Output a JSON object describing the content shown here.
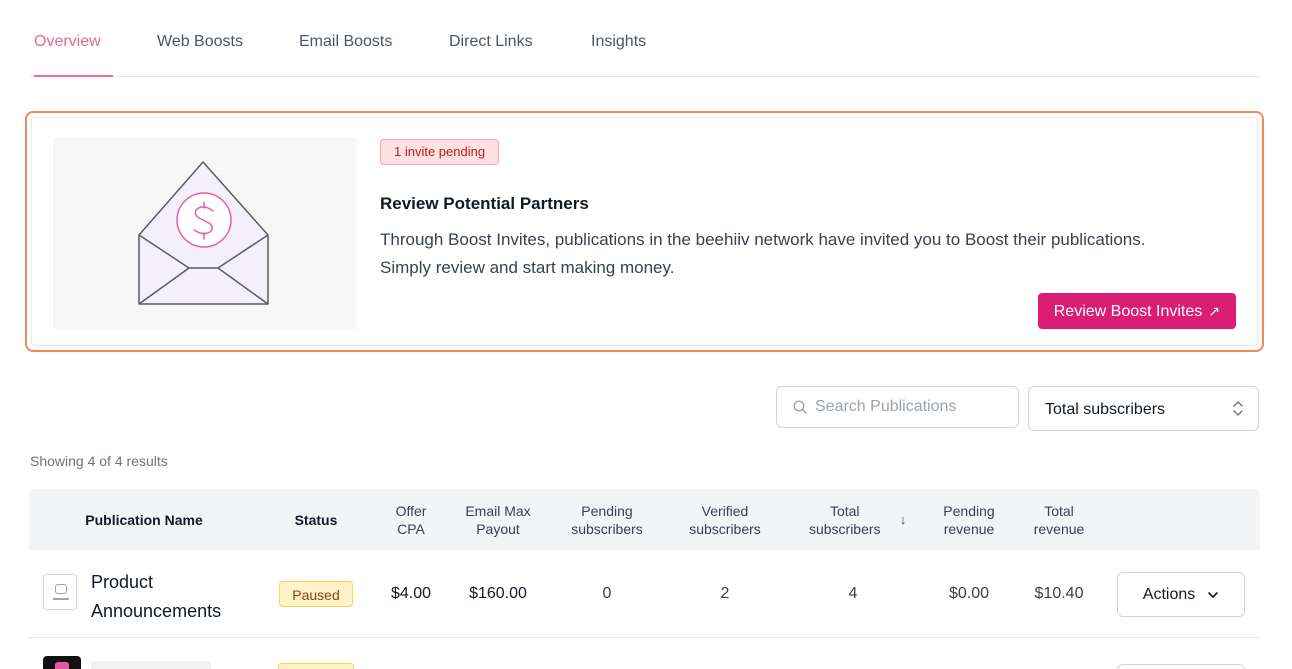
{
  "tabs": [
    {
      "label": "Overview",
      "active": true
    },
    {
      "label": "Web Boosts",
      "active": false
    },
    {
      "label": "Email Boosts",
      "active": false
    },
    {
      "label": "Direct Links",
      "active": false
    },
    {
      "label": "Insights",
      "active": false
    }
  ],
  "banner": {
    "badge": "1 invite pending",
    "title": "Review Potential Partners",
    "description": "Through Boost Invites, publications in the beehiiv network have invited you to Boost their publications. Simply review and start making money.",
    "button_label": "Review Boost Invites",
    "button_icon": "arrow-up-right-icon",
    "illustration_icon": "envelope-dollar-icon"
  },
  "search": {
    "placeholder": "Search Publications",
    "value": ""
  },
  "sort": {
    "selected": "Total subscribers"
  },
  "results_text": "Showing 4 of 4 results",
  "table": {
    "columns": [
      {
        "label": "Publication Name"
      },
      {
        "label": "Status"
      },
      {
        "label": "Offer CPA"
      },
      {
        "label": "Email Max Payout"
      },
      {
        "label": "Pending subscribers"
      },
      {
        "label": "Verified subscribers"
      },
      {
        "label": "Total subscribers",
        "sorted": "desc"
      },
      {
        "label": "Pending revenue"
      },
      {
        "label": "Total revenue"
      }
    ],
    "rows": [
      {
        "name": "Product Announcements",
        "status": "Paused",
        "offer_cpa": "$4.00",
        "email_max_payout": "$160.00",
        "pending_subscribers": "0",
        "verified_subscribers": "2",
        "total_subscribers": "4",
        "pending_revenue": "$0.00",
        "total_revenue": "$10.40",
        "actions_label": "Actions"
      }
    ]
  },
  "colors": {
    "accent": "#da1e74",
    "tab_active": "#e8679a",
    "banner_border": "#f08a55",
    "badge_bg": "#fee2e2",
    "paused_bg": "#fef3c7"
  }
}
